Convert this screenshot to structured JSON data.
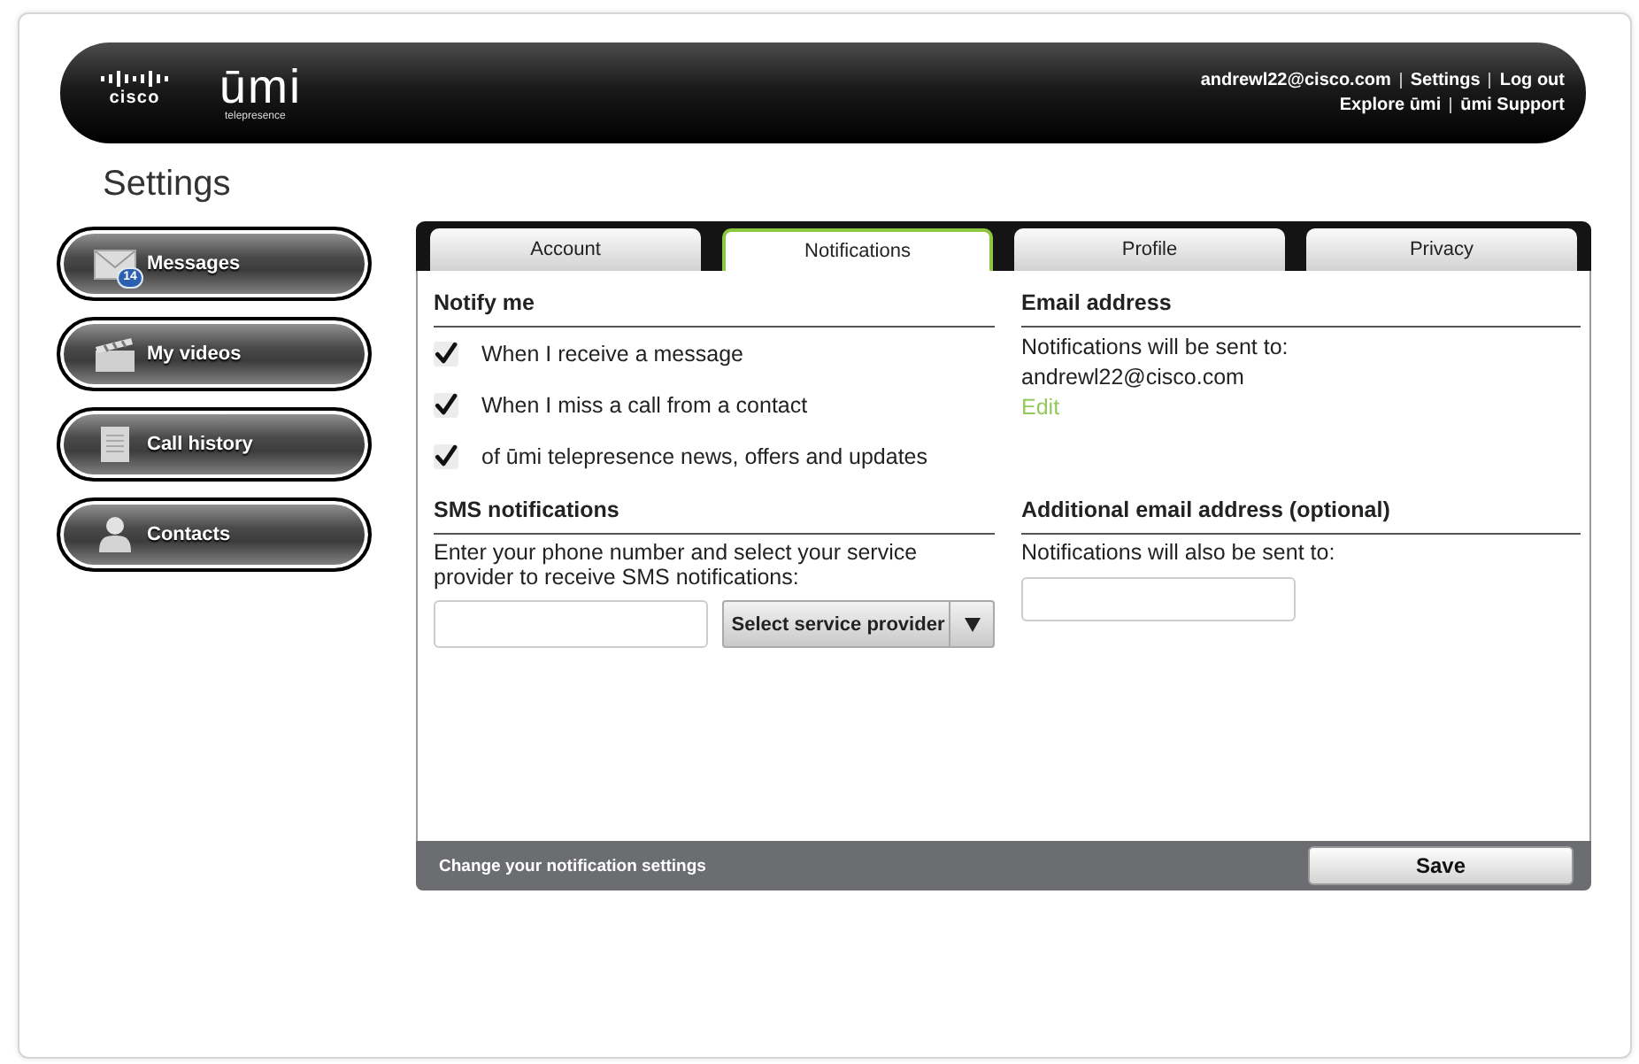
{
  "header": {
    "logo": {
      "brand": "cisco",
      "product": "ūmi",
      "tagline": "telepresence"
    },
    "link_rows": [
      {
        "links": [
          "andrewl22@cisco.com",
          "Settings",
          "Log out"
        ]
      },
      {
        "links": [
          "Explore ūmi",
          "ūmi Support"
        ]
      }
    ]
  },
  "page_title": "Settings",
  "sidebar": {
    "items": [
      {
        "label": "Messages",
        "badge": "14"
      },
      {
        "label": "My videos"
      },
      {
        "label": "Call history"
      },
      {
        "label": "Contacts"
      }
    ]
  },
  "tabs": [
    {
      "label": "Account",
      "selected": false
    },
    {
      "label": "Notifications",
      "selected": true
    },
    {
      "label": "Profile",
      "selected": false
    },
    {
      "label": "Privacy",
      "selected": false
    }
  ],
  "notifications_panel": {
    "notify_me": {
      "heading": "Notify me",
      "options": [
        {
          "label": "When I receive a message",
          "checked": true
        },
        {
          "label": "When I miss a call from a contact",
          "checked": true
        },
        {
          "label": "of ūmi telepresence news, offers and updates",
          "checked": true
        }
      ]
    },
    "email_address": {
      "heading": "Email address",
      "note": "Notifications will be sent to:",
      "email": "andrewl22@cisco.com",
      "edit_link": "Edit"
    },
    "sms_notifications": {
      "heading": "SMS notifications",
      "description": "Enter your phone number and select your service provider to receive SMS notifications:",
      "provider_select": "Select service provider"
    },
    "additional_email": {
      "heading": "Additional email address (optional)",
      "note": "Notifications will also be sent to:"
    },
    "footer": {
      "hint": "Change your notification settings",
      "save_button": "Save"
    }
  }
}
